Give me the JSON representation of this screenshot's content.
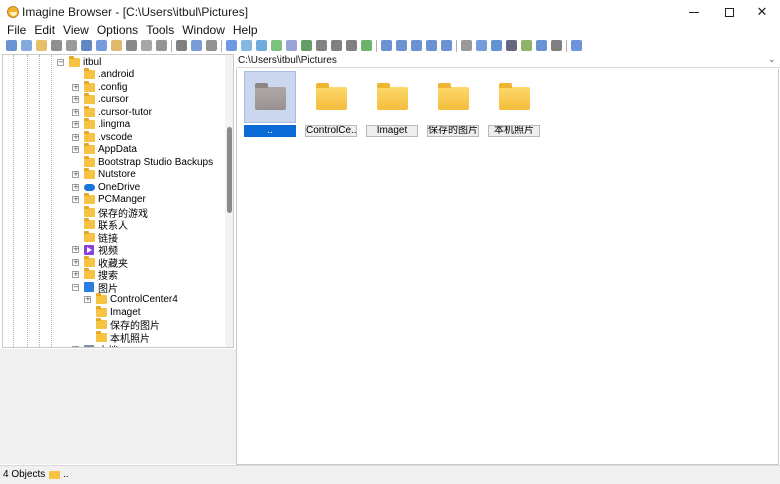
{
  "window": {
    "title": "Imagine Browser - [C:\\Users\\itbul\\Pictures]",
    "minimize": "–",
    "maximize": "□",
    "close": "✕"
  },
  "menu": [
    "File",
    "Edit",
    "View",
    "Options",
    "Tools",
    "Window",
    "Help"
  ],
  "toolbar_icons": [
    "view-icon",
    "open-icon",
    "folder-open-icon",
    "save-icon",
    "print-icon",
    "info-icon",
    "copy-icon",
    "rename-icon",
    "cut-icon",
    "delete-icon",
    "properties-icon",
    "scissors-icon",
    "clipboard-copy-icon",
    "paste-icon",
    "layout-icon",
    "filter-icon",
    "refresh-icon",
    "sort-icon",
    "list-icon",
    "image-icon",
    "slideshow-icon",
    "prev-icon",
    "next-icon",
    "reload-icon",
    "thumbnails-icon",
    "details-icon",
    "panel-icon",
    "split-icon",
    "grid-icon",
    "link-icon",
    "search-icon",
    "compare-icon",
    "monitor-icon",
    "resize-icon",
    "convert-icon",
    "edit-icon",
    "help-icon"
  ],
  "tree": [
    {
      "label": "itbul",
      "level": 0,
      "expander": "−",
      "icon": "folder"
    },
    {
      "label": ".android",
      "level": 1,
      "expander": "",
      "icon": "folder"
    },
    {
      "label": ".config",
      "level": 1,
      "expander": "+",
      "icon": "folder"
    },
    {
      "label": ".cursor",
      "level": 1,
      "expander": "+",
      "icon": "folder"
    },
    {
      "label": ".cursor-tutor",
      "level": 1,
      "expander": "+",
      "icon": "folder"
    },
    {
      "label": ".lingma",
      "level": 1,
      "expander": "+",
      "icon": "folder"
    },
    {
      "label": ".vscode",
      "level": 1,
      "expander": "+",
      "icon": "folder"
    },
    {
      "label": "AppData",
      "level": 1,
      "expander": "+",
      "icon": "folder"
    },
    {
      "label": "Bootstrap Studio Backups",
      "level": 1,
      "expander": "",
      "icon": "folder"
    },
    {
      "label": "Nutstore",
      "level": 1,
      "expander": "+",
      "icon": "folder"
    },
    {
      "label": "OneDrive",
      "level": 1,
      "expander": "+",
      "icon": "cloud"
    },
    {
      "label": "PCManger",
      "level": 1,
      "expander": "+",
      "icon": "folder"
    },
    {
      "label": "保存的游戏",
      "level": 1,
      "expander": "",
      "icon": "folder"
    },
    {
      "label": "联系人",
      "level": 1,
      "expander": "",
      "icon": "folder"
    },
    {
      "label": "链接",
      "level": 1,
      "expander": "",
      "icon": "folder"
    },
    {
      "label": "视频",
      "level": 1,
      "expander": "+",
      "icon": "video"
    },
    {
      "label": "收藏夹",
      "level": 1,
      "expander": "+",
      "icon": "folder"
    },
    {
      "label": "搜索",
      "level": 1,
      "expander": "+",
      "icon": "folder"
    },
    {
      "label": "图片",
      "level": 1,
      "expander": "−",
      "icon": "picture"
    },
    {
      "label": "ControlCenter4",
      "level": 2,
      "expander": "+",
      "icon": "folder"
    },
    {
      "label": "Imaget",
      "level": 2,
      "expander": "",
      "icon": "folder"
    },
    {
      "label": "保存的图片",
      "level": 2,
      "expander": "",
      "icon": "folder"
    },
    {
      "label": "本机照片",
      "level": 2,
      "expander": "",
      "icon": "folder"
    },
    {
      "label": "文档",
      "level": 1,
      "expander": "+",
      "icon": "document"
    }
  ],
  "address": {
    "path": "C:\\Users\\itbul\\Pictures",
    "dropdown_icon": "chevron-down-icon"
  },
  "thumbnails": [
    {
      "label": "..",
      "selected": true,
      "type": "parent-folder"
    },
    {
      "label": "ControlCe...",
      "selected": false,
      "type": "folder"
    },
    {
      "label": "Imaget",
      "selected": false,
      "type": "folder"
    },
    {
      "label": "保存的图片",
      "selected": false,
      "type": "folder"
    },
    {
      "label": "本机照片",
      "selected": false,
      "type": "folder"
    }
  ],
  "status": {
    "count": "4 Objects",
    "current": ".."
  },
  "colors": {
    "selection": "#0c6ad6",
    "folder": "#f6c343",
    "selected_thumb_bg": "#cbd7ef"
  }
}
